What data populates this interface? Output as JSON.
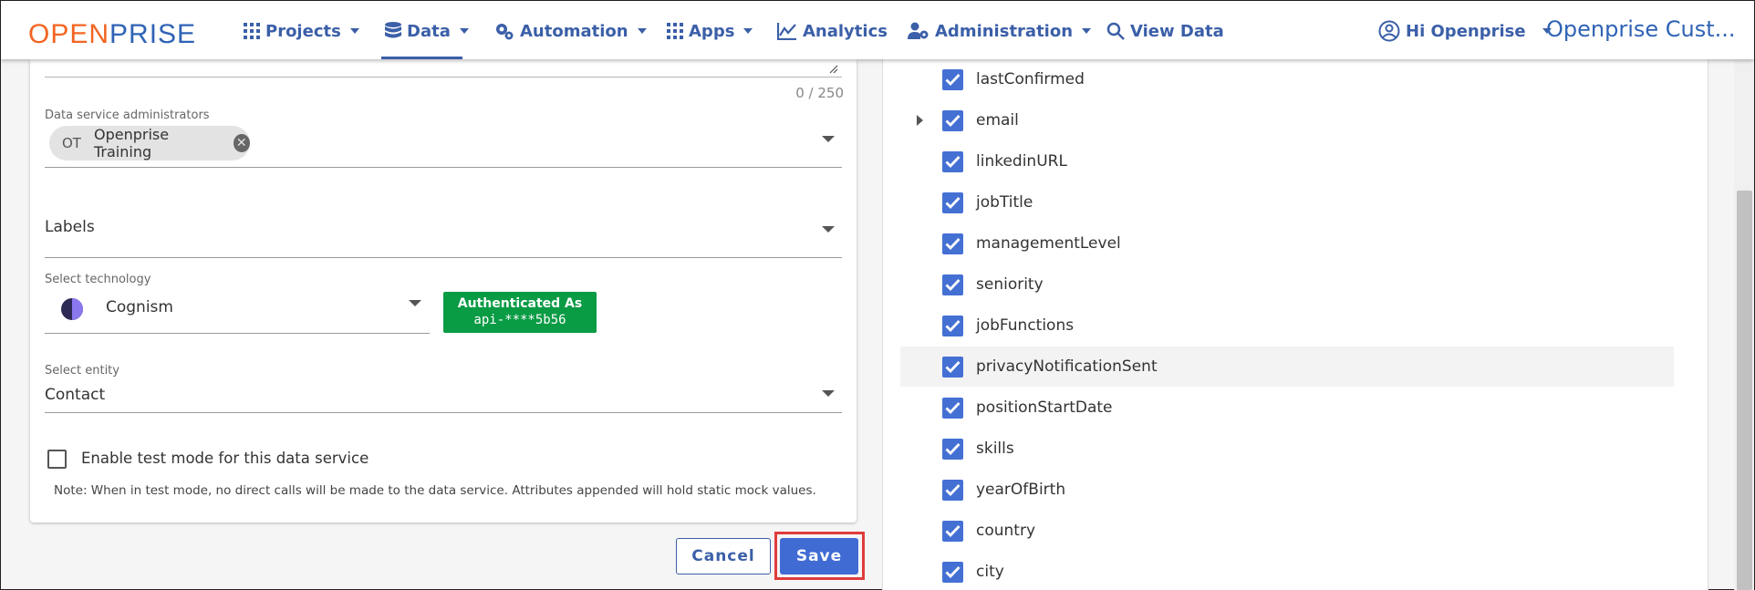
{
  "nav": {
    "logo_a": "OPEN",
    "logo_b": "PRISE",
    "items": [
      {
        "label": "Projects"
      },
      {
        "label": "Data"
      },
      {
        "label": "Automation"
      },
      {
        "label": "Apps"
      },
      {
        "label": "Analytics"
      },
      {
        "label": "Administration"
      },
      {
        "label": "View Data"
      }
    ],
    "user_greeting": "Hi Openprise",
    "account_title": "Openprise Cust..."
  },
  "form": {
    "description_counter": "0 / 250",
    "admins_label": "Data service administrators",
    "admin_chip": {
      "initials": "OT",
      "name": "Openprise Training"
    },
    "labels_placeholder": "Labels",
    "technology_label": "Select technology",
    "technology_value": "Cognism",
    "auth_badge": {
      "line1": "Authenticated As",
      "line2": "api-****5b56"
    },
    "entity_label": "Select entity",
    "entity_value": "Contact",
    "test_mode_label": "Enable test mode for this data service",
    "test_mode_checked": false,
    "note": "Note: When in test mode, no direct calls will be made to the data service. Attributes appended will hold static mock values."
  },
  "actions": {
    "cancel_label": "Cancel",
    "save_label": "Save"
  },
  "attributes": [
    {
      "name": "lastConfirmed",
      "checked": true
    },
    {
      "name": "email",
      "checked": true,
      "expandable": true
    },
    {
      "name": "linkedinURL",
      "checked": true
    },
    {
      "name": "jobTitle",
      "checked": true
    },
    {
      "name": "managementLevel",
      "checked": true
    },
    {
      "name": "seniority",
      "checked": true
    },
    {
      "name": "jobFunctions",
      "checked": true
    },
    {
      "name": "privacyNotificationSent",
      "checked": true,
      "highlighted": true
    },
    {
      "name": "positionStartDate",
      "checked": true
    },
    {
      "name": "skills",
      "checked": true
    },
    {
      "name": "yearOfBirth",
      "checked": true
    },
    {
      "name": "country",
      "checked": true
    },
    {
      "name": "city",
      "checked": true
    }
  ],
  "colors": {
    "brand_orange": "#f26522",
    "brand_blue": "#2f63b5",
    "nav_blue": "#3b5fa8",
    "checkbox_blue": "#4470d4",
    "auth_green": "#0a9b45",
    "save_blue": "#3f6bd3",
    "highlight_red": "#e03c3c"
  }
}
